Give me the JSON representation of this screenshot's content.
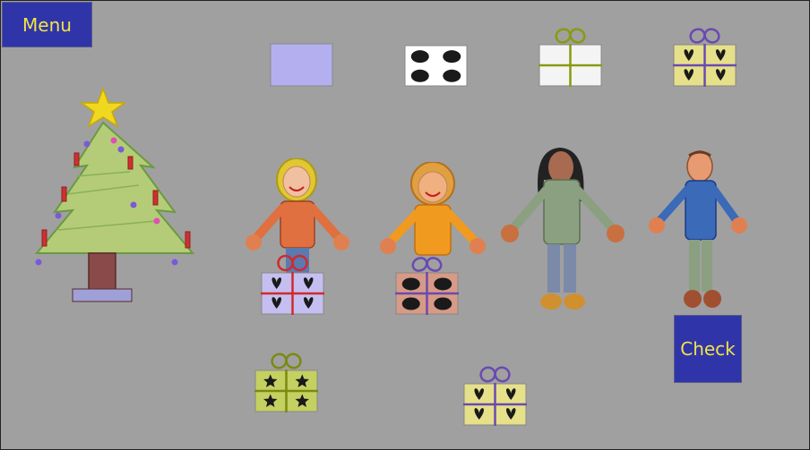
{
  "buttons": {
    "menu_label": "Menu",
    "check_label": "Check"
  },
  "colors": {
    "background": "#a0a0a0",
    "button_bg": "#2f35a8",
    "button_text": "#f2e24a"
  },
  "gift_designs": {
    "lavender-plain": {
      "box": "#b4b0f0",
      "pattern": "none",
      "ribbon": "none"
    },
    "white-dots": {
      "box": "#ffffff",
      "pattern": "dots",
      "ribbon": "none"
    },
    "white-ribbon-olive": {
      "box": "#f4f4f4",
      "pattern": "none",
      "ribbon": "#8a9a10"
    },
    "yellow-hearts-purple": {
      "box": "#e6e08a",
      "pattern": "hearts",
      "ribbon": "#6a4ab0"
    },
    "lavender-hearts-red": {
      "box": "#c4bff0",
      "pattern": "hearts",
      "ribbon": "#d02a2a"
    },
    "salmon-dots-purple": {
      "box": "#d79a86",
      "pattern": "dots",
      "ribbon": "#6a4ab0"
    },
    "green-stars-olive": {
      "box": "#c4d060",
      "pattern": "stars",
      "ribbon": "#7a8a10"
    }
  }
}
